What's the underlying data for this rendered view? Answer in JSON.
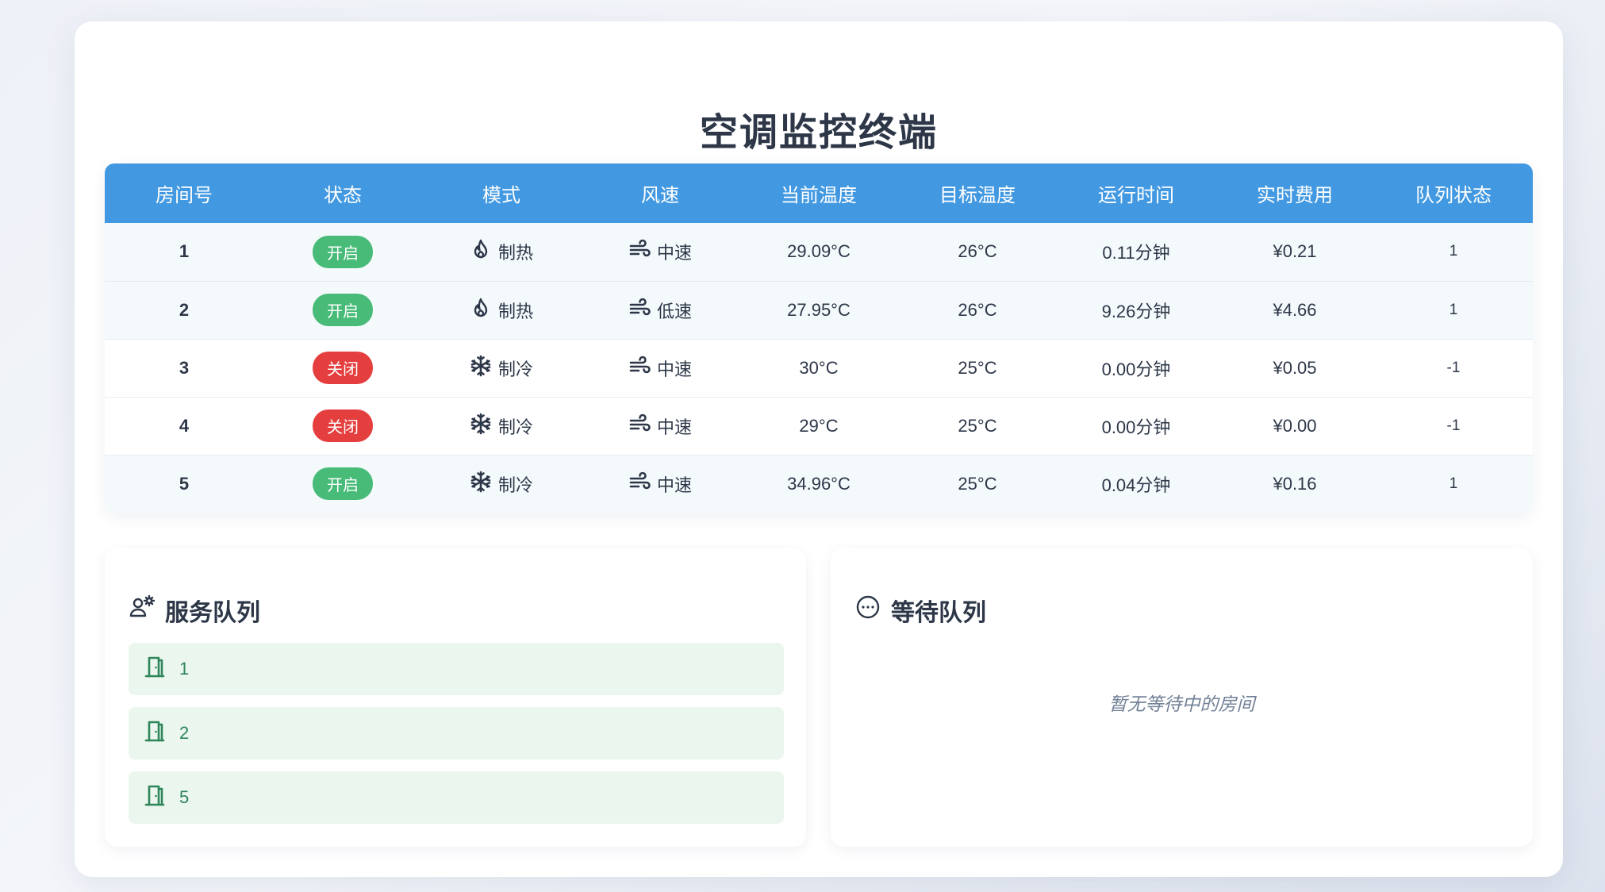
{
  "app": {
    "title": "空调监控终端"
  },
  "table": {
    "headers": [
      "房间号",
      "状态",
      "模式",
      "风速",
      "当前温度",
      "目标温度",
      "运行时间",
      "实时费用",
      "队列状态"
    ],
    "rows": [
      {
        "room": "1",
        "status": "开启",
        "status_type": "on",
        "mode": "制热",
        "mode_icon": "flame-icon",
        "fan": "中速",
        "fan_icon": "wind-icon",
        "current_temp": "29.09°C",
        "target_temp": "26°C",
        "runtime": "0.11分钟",
        "cost": "¥0.21",
        "queue_status": "1"
      },
      {
        "room": "2",
        "status": "开启",
        "status_type": "on",
        "mode": "制热",
        "mode_icon": "flame-icon",
        "fan": "低速",
        "fan_icon": "wind-icon",
        "current_temp": "27.95°C",
        "target_temp": "26°C",
        "runtime": "9.26分钟",
        "cost": "¥4.66",
        "queue_status": "1"
      },
      {
        "room": "3",
        "status": "关闭",
        "status_type": "off",
        "mode": "制冷",
        "mode_icon": "snowflake-icon",
        "fan": "中速",
        "fan_icon": "wind-icon",
        "current_temp": "30°C",
        "target_temp": "25°C",
        "runtime": "0.00分钟",
        "cost": "¥0.05",
        "queue_status": "-1"
      },
      {
        "room": "4",
        "status": "关闭",
        "status_type": "off",
        "mode": "制冷",
        "mode_icon": "snowflake-icon",
        "fan": "中速",
        "fan_icon": "wind-icon",
        "current_temp": "29°C",
        "target_temp": "25°C",
        "runtime": "0.00分钟",
        "cost": "¥0.00",
        "queue_status": "-1"
      },
      {
        "room": "5",
        "status": "开启",
        "status_type": "on",
        "mode": "制冷",
        "mode_icon": "snowflake-icon",
        "fan": "中速",
        "fan_icon": "wind-icon",
        "current_temp": "34.96°C",
        "target_temp": "25°C",
        "runtime": "0.04分钟",
        "cost": "¥0.16",
        "queue_status": "1"
      }
    ]
  },
  "service_queue": {
    "title": "服务队列",
    "icon": "user-gear-icon",
    "items": [
      {
        "label": "1",
        "icon": "door-icon"
      },
      {
        "label": "2",
        "icon": "door-icon"
      },
      {
        "label": "5",
        "icon": "door-icon"
      }
    ]
  },
  "waiting_queue": {
    "title": "等待队列",
    "icon": "ellipsis-circle-icon",
    "empty_text": "暂无等待中的房间"
  },
  "colors": {
    "header_blue": "#4299e1",
    "status_on": "#48bb78",
    "status_off": "#e53e3e",
    "queue_item_bg": "#eaf6ee",
    "queue_item_text": "#2f855a"
  }
}
